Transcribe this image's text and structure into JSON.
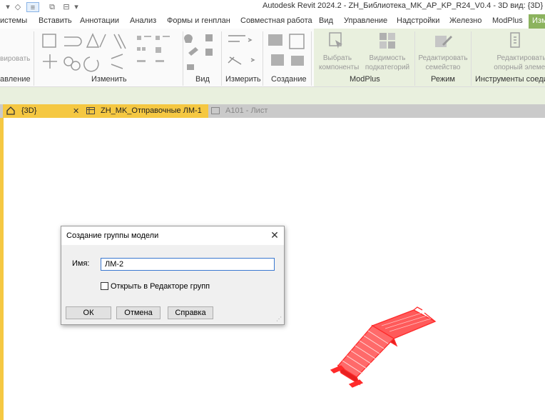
{
  "window": {
    "title": "Autodesk Revit 2024.2 - ZH_Библиотека_MK_AP_KP_R24_V0.4 - 3D вид: {3D}"
  },
  "ribbon_tabs": [
    "истемы",
    "Вставить",
    "Аннотации",
    "Анализ",
    "Формы и генплан",
    "Совместная работа",
    "Вид",
    "Управление",
    "Надстройки",
    "Железно",
    "ModPlus",
    "Изм"
  ],
  "active_tab_index": 11,
  "ribbon": {
    "partial_button": "вировать",
    "panels": {
      "edit_partial": "авление",
      "modify": "Изменить",
      "view": "Вид",
      "measure": "Измерить",
      "create": "Создание",
      "modplus": "ModPlus",
      "mode": "Режим",
      "tools": "Инструменты соеди"
    },
    "buttons": {
      "select_components": [
        "Выбрать",
        "компоненты"
      ],
      "subcategory_visibility": [
        "Видимость",
        "подкатегорий"
      ],
      "edit_family": [
        "Редактировать",
        "семейство"
      ],
      "edit_reference": [
        "Редактировать",
        "опорный элемен"
      ]
    }
  },
  "view_tabs": [
    {
      "label": "{3D}",
      "icon": "home-icon",
      "active": true,
      "close": "✕"
    },
    {
      "label": "ZH_MK_Отправочные ЛМ-1",
      "icon": "schedule-icon",
      "active": false
    },
    {
      "label": "A101 - Лист",
      "icon": "sheet-icon",
      "active": false
    }
  ],
  "dialog": {
    "title": "Создание группы модели",
    "close_glyph": "✕",
    "name_label": "Имя:",
    "name_value": "ЛМ-2",
    "open_in_editor_label": "Открыть в Редакторе групп",
    "open_in_editor_checked": false,
    "ok_label": "ОК",
    "cancel_label": "Отмена",
    "help_label": "Справка"
  },
  "colors": {
    "accent_tab": "#8cb35e",
    "context_panel": "#e9f0de",
    "stair_model": "#ff2b2b",
    "input_focus": "#3a78d0"
  }
}
